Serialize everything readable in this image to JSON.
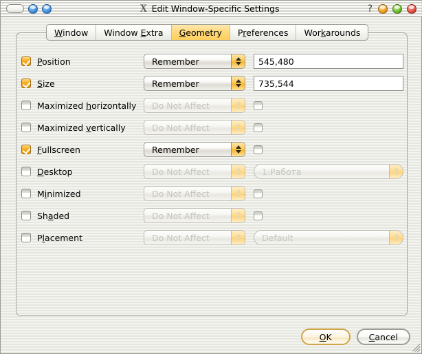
{
  "window": {
    "title": "Edit Window-Specific Settings",
    "x_logo": "X",
    "help_label": "?",
    "titlebar_left_buttons": [
      {
        "name": "shade-pill-button",
        "shape": "pill"
      },
      {
        "name": "sticky-button",
        "color": "#4d9ae8"
      },
      {
        "name": "above-others-button",
        "color": "#4d9ae8"
      }
    ],
    "titlebar_right_buttons": [
      {
        "name": "minimize-button",
        "color": "#f2a62a"
      },
      {
        "name": "maximize-button",
        "color": "#77c437"
      },
      {
        "name": "close-button",
        "color": "#e8574a"
      }
    ]
  },
  "tabs": [
    {
      "label": "Window",
      "mnemonic": "W",
      "active": false
    },
    {
      "label": "Window Extra",
      "mnemonic": "E",
      "active": false
    },
    {
      "label": "Geometry",
      "mnemonic": "G",
      "active": true
    },
    {
      "label": "Preferences",
      "mnemonic": "r",
      "active": false
    },
    {
      "label": "Workarounds",
      "mnemonic": "k",
      "active": false
    }
  ],
  "rows": [
    {
      "label": "Position",
      "mnemonic": "P",
      "checked": true,
      "rule": "Remember",
      "rule_disabled": false,
      "trailing": {
        "type": "text-input",
        "value": "545,480",
        "disabled": false
      }
    },
    {
      "label": "Size",
      "mnemonic": "S",
      "checked": true,
      "rule": "Remember",
      "rule_disabled": false,
      "trailing": {
        "type": "text-input",
        "value": "735,544",
        "disabled": false
      }
    },
    {
      "label": "Maximized horizontally",
      "mnemonic": "h",
      "checked": false,
      "rule": "Do Not Affect",
      "rule_disabled": true,
      "trailing": {
        "type": "checkbox",
        "checked": false,
        "disabled": true
      }
    },
    {
      "label": "Maximized vertically",
      "mnemonic": "v",
      "checked": false,
      "rule": "Do Not Affect",
      "rule_disabled": true,
      "trailing": {
        "type": "checkbox",
        "checked": false,
        "disabled": true
      }
    },
    {
      "label": "Fullscreen",
      "mnemonic": "F",
      "checked": true,
      "rule": "Remember",
      "rule_disabled": false,
      "trailing": {
        "type": "checkbox",
        "checked": false,
        "disabled": false
      }
    },
    {
      "label": "Desktop",
      "mnemonic": "D",
      "checked": false,
      "rule": "Do Not Affect",
      "rule_disabled": true,
      "trailing": {
        "type": "combo",
        "value": "1:Работа",
        "disabled": true
      }
    },
    {
      "label": "Minimized",
      "mnemonic": "i",
      "checked": false,
      "rule": "Do Not Affect",
      "rule_disabled": true,
      "trailing": {
        "type": "checkbox",
        "checked": false,
        "disabled": true
      }
    },
    {
      "label": "Shaded",
      "mnemonic": "a",
      "checked": false,
      "rule": "Do Not Affect",
      "rule_disabled": true,
      "trailing": {
        "type": "checkbox",
        "checked": false,
        "disabled": true
      }
    },
    {
      "label": "Placement",
      "mnemonic": "l",
      "checked": false,
      "rule": "Do Not Affect",
      "rule_disabled": true,
      "trailing": {
        "type": "combo",
        "value": "Default",
        "disabled": true
      }
    }
  ],
  "buttons": {
    "ok": {
      "label": "OK",
      "mnemonic": "O",
      "default": true
    },
    "cancel": {
      "label": "Cancel",
      "mnemonic": "C",
      "default": false
    }
  },
  "colors": {
    "accent_amber": "#f6ad1f",
    "tab_active": "#ffd97a",
    "window_bg": "#eeeeea",
    "default_button_border": "#d0a545"
  }
}
